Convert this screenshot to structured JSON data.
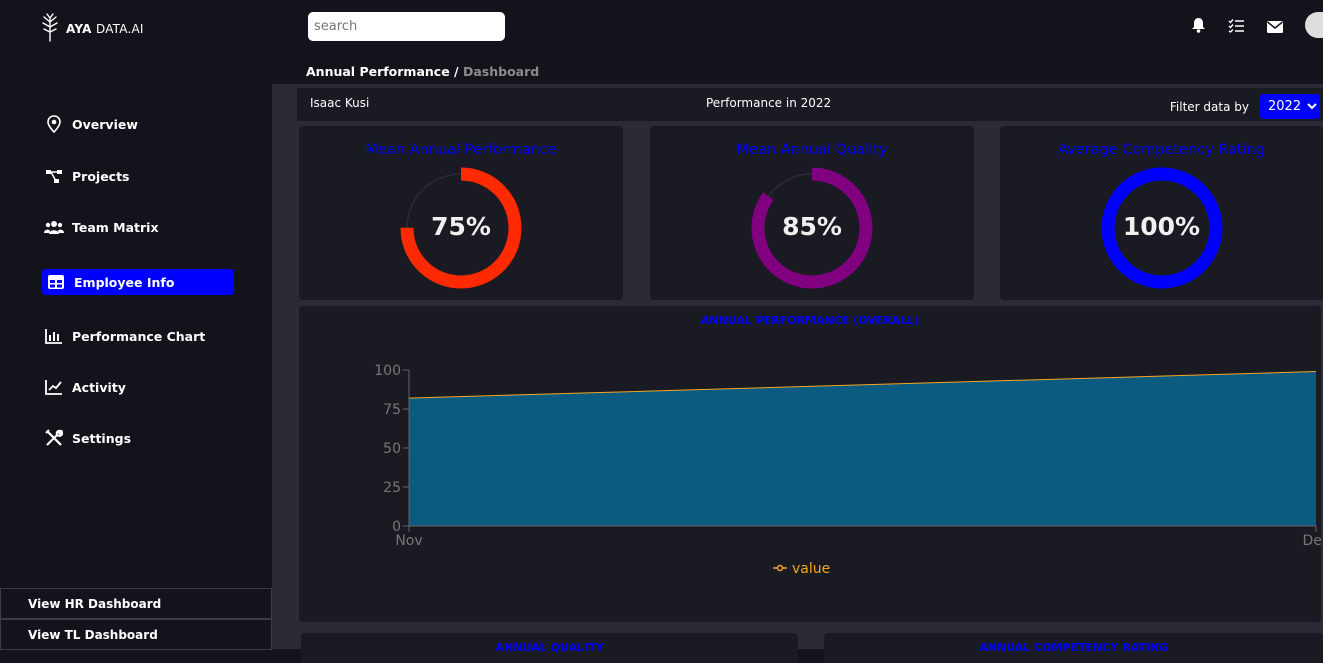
{
  "brand": {
    "bold": "AYA",
    "light": "DATA.AI"
  },
  "search": {
    "placeholder": "search"
  },
  "breadcrumb": {
    "current": "Annual Performance /",
    "section": "Dashboard"
  },
  "sidebar": {
    "items": [
      {
        "label": "Overview",
        "icon": "location-pin-icon"
      },
      {
        "label": "Projects",
        "icon": "project-flow-icon"
      },
      {
        "label": "Team Matrix",
        "icon": "users-icon"
      },
      {
        "label": "Employee Info",
        "icon": "table-icon",
        "active": true
      },
      {
        "label": "Performance Chart",
        "icon": "bar-chart-icon"
      },
      {
        "label": "Activity",
        "icon": "line-chart-icon"
      },
      {
        "label": "Settings",
        "icon": "tools-icon"
      }
    ],
    "bottom": [
      "View HR Dashboard",
      "View TL Dashboard"
    ]
  },
  "infobar": {
    "employee": "Isaac Kusi",
    "performance_label": "Performance in 2022",
    "filter_label": "Filter data by",
    "year": "2022"
  },
  "kpis": [
    {
      "title": "Mean Annual Performance",
      "value": 75,
      "label": "75%",
      "color": "#ff2a00"
    },
    {
      "title": "Mean Annual Quality",
      "value": 85,
      "label": "85%",
      "color": "#800080"
    },
    {
      "title": "Average Competency Rating",
      "value": 100,
      "label": "100%",
      "color": "#0000ff"
    }
  ],
  "chart_data": {
    "type": "area",
    "title": "ANNUAL PERFORMANCE (OVERALL)",
    "categories": [
      "Nov",
      "Dec"
    ],
    "series": [
      {
        "name": "value",
        "values": [
          82,
          99
        ]
      }
    ],
    "yticks": [
      0,
      25,
      50,
      75,
      100
    ],
    "ylim": [
      0,
      100
    ],
    "grid": false,
    "legend": "bottom",
    "colors": {
      "fill": "#0b5a80",
      "line": "#f5a623"
    }
  },
  "bottom_cards": [
    "ANNUAL QUALITY",
    "ANNUAL COMPETENCY RATING"
  ],
  "colors": {
    "accent": "#0000ff",
    "background": "#13141b",
    "panel": "#191a22"
  }
}
